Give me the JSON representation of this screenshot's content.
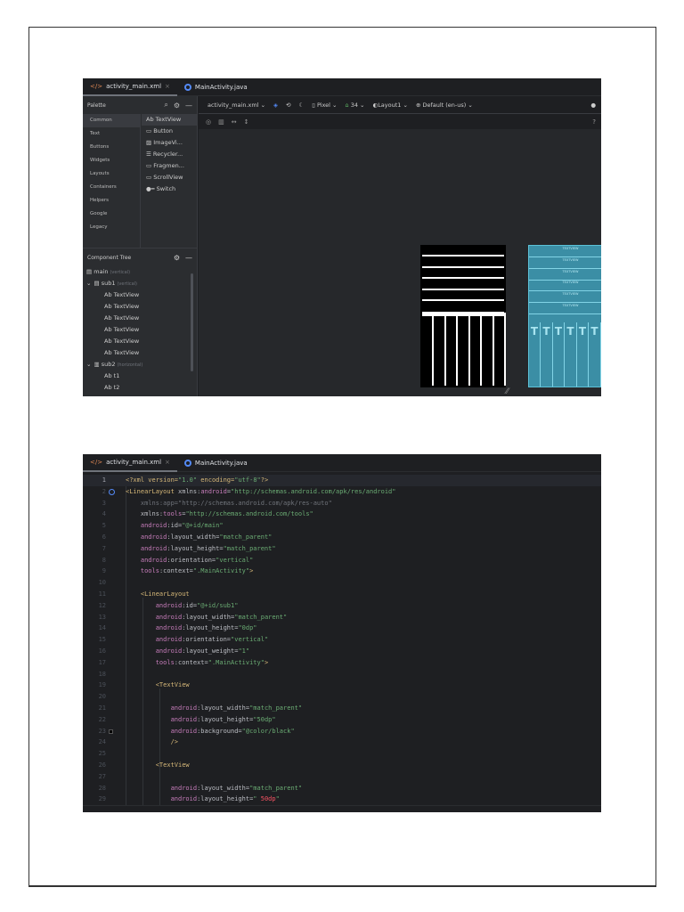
{
  "shot1": {
    "tabs": [
      {
        "label": "activity_main.xml",
        "close": "×"
      },
      {
        "label": "MainActivity.java"
      }
    ],
    "palette": {
      "title": "Palette",
      "categories": [
        "Common",
        "Text",
        "Buttons",
        "Widgets",
        "Layouts",
        "Containers",
        "Helpers",
        "Google",
        "Legacy"
      ],
      "widgets": [
        {
          "icon": "Ab",
          "label": "TextView"
        },
        {
          "icon": "▭",
          "label": "Button"
        },
        {
          "icon": "▨",
          "label": "ImageVi..."
        },
        {
          "icon": "☰",
          "label": "Recycler..."
        },
        {
          "icon": "▭",
          "label": "Fragmen..."
        },
        {
          "icon": "▭",
          "label": "ScrollView"
        },
        {
          "icon": "●━",
          "label": "Switch"
        }
      ]
    },
    "tree": {
      "title": "Component Tree",
      "rows": [
        {
          "indent": 0,
          "chev": "",
          "icon": "▤",
          "label": "main",
          "hint": "(vertical)"
        },
        {
          "indent": 0,
          "chev": "⌄",
          "icon": "▤",
          "label": "sub1",
          "hint": "(vertical)"
        },
        {
          "indent": 2,
          "chev": "",
          "icon": "Ab",
          "label": "TextView",
          "hint": ""
        },
        {
          "indent": 2,
          "chev": "",
          "icon": "Ab",
          "label": "TextView",
          "hint": ""
        },
        {
          "indent": 2,
          "chev": "",
          "icon": "Ab",
          "label": "TextView",
          "hint": ""
        },
        {
          "indent": 2,
          "chev": "",
          "icon": "Ab",
          "label": "TextView",
          "hint": ""
        },
        {
          "indent": 2,
          "chev": "",
          "icon": "Ab",
          "label": "TextView",
          "hint": ""
        },
        {
          "indent": 2,
          "chev": "",
          "icon": "Ab",
          "label": "TextView",
          "hint": ""
        },
        {
          "indent": 0,
          "chev": "⌄",
          "icon": "▥",
          "label": "sub2",
          "hint": "(horizontal)"
        },
        {
          "indent": 2,
          "chev": "",
          "icon": "Ab",
          "label": "t1",
          "hint": ""
        },
        {
          "indent": 2,
          "chev": "",
          "icon": "Ab",
          "label": "t2",
          "hint": ""
        }
      ]
    },
    "toolbar": {
      "file": "activity_main.xml ⌄",
      "device": "Pixel ⌄",
      "api": "34 ⌄",
      "theme": "Layout1 ⌄",
      "locale": "Default (en-us) ⌄",
      "help": "?"
    },
    "blueprint_label": "TEXTVIEW"
  },
  "shot2": {
    "tabs": [
      {
        "label": "activity_main.xml",
        "close": "×"
      },
      {
        "label": "MainActivity.java"
      }
    ],
    "lines": [
      [
        [
          "<?xml version=",
          "t-tag"
        ],
        [
          "\"1.0\"",
          "t-v"
        ],
        [
          " encoding=",
          "t-tag"
        ],
        [
          "\"utf-8\"",
          "t-v"
        ],
        [
          "?>",
          "t-tag"
        ]
      ],
      [
        [
          "<LinearLayout ",
          "t-tag"
        ],
        [
          "xmlns:",
          "t-at"
        ],
        [
          "android",
          "t-ns"
        ],
        [
          "=",
          "t-at"
        ],
        [
          "\"http://schemas.android.com/apk/res/android\"",
          "t-v"
        ]
      ],
      [
        [
          "    xmlns:app=\"http://schemas.android.com/apk/res-auto\"",
          "t-dim"
        ]
      ],
      [
        [
          "    xmlns:",
          "t-at"
        ],
        [
          "tools",
          "t-ns"
        ],
        [
          "=",
          "t-at"
        ],
        [
          "\"http://schemas.android.com/tools\"",
          "t-v"
        ]
      ],
      [
        [
          "    android",
          "t-ns"
        ],
        [
          ":id=",
          "t-at"
        ],
        [
          "\"@+id/main\"",
          "t-v"
        ]
      ],
      [
        [
          "    android",
          "t-ns"
        ],
        [
          ":layout_width=",
          "t-at"
        ],
        [
          "\"match_parent\"",
          "t-v"
        ]
      ],
      [
        [
          "    android",
          "t-ns"
        ],
        [
          ":layout_height=",
          "t-at"
        ],
        [
          "\"match_parent\"",
          "t-v"
        ]
      ],
      [
        [
          "    android",
          "t-ns"
        ],
        [
          ":orientation=",
          "t-at"
        ],
        [
          "\"vertical\"",
          "t-v"
        ]
      ],
      [
        [
          "    tools",
          "t-ns"
        ],
        [
          ":context=",
          "t-at"
        ],
        [
          "\".MainActivity\"",
          "t-v"
        ],
        [
          ">",
          "t-tag"
        ]
      ],
      [],
      [
        [
          "    <LinearLayout",
          "t-tag"
        ]
      ],
      [
        [
          "        android",
          "t-ns"
        ],
        [
          ":id=",
          "t-at"
        ],
        [
          "\"@+id/sub1\"",
          "t-v"
        ]
      ],
      [
        [
          "        android",
          "t-ns"
        ],
        [
          ":layout_width=",
          "t-at"
        ],
        [
          "\"match_parent\"",
          "t-v"
        ]
      ],
      [
        [
          "        android",
          "t-ns"
        ],
        [
          ":layout_height=",
          "t-at"
        ],
        [
          "\"0dp\"",
          "t-v"
        ]
      ],
      [
        [
          "        android",
          "t-ns"
        ],
        [
          ":orientation=",
          "t-at"
        ],
        [
          "\"vertical\"",
          "t-v"
        ]
      ],
      [
        [
          "        android",
          "t-ns"
        ],
        [
          ":layout_weight=",
          "t-at"
        ],
        [
          "\"1\"",
          "t-v"
        ]
      ],
      [
        [
          "        tools",
          "t-ns"
        ],
        [
          ":context=",
          "t-at"
        ],
        [
          "\".MainActivity\"",
          "t-v"
        ],
        [
          ">",
          "t-tag"
        ]
      ],
      [],
      [
        [
          "        <TextView",
          "t-tag"
        ]
      ],
      [],
      [
        [
          "            android",
          "t-ns"
        ],
        [
          ":layout_width=",
          "t-at"
        ],
        [
          "\"match_parent\"",
          "t-v"
        ]
      ],
      [
        [
          "            android",
          "t-ns"
        ],
        [
          ":layout_height=",
          "t-at"
        ],
        [
          "\"50dp\"",
          "t-v"
        ]
      ],
      [
        [
          "            android",
          "t-ns"
        ],
        [
          ":background=",
          "t-at"
        ],
        [
          "\"@color/black\"",
          "t-v"
        ]
      ],
      [
        [
          "            />",
          "t-tag"
        ]
      ],
      [],
      [
        [
          "        <TextView",
          "t-tag"
        ]
      ],
      [],
      [
        [
          "            android",
          "t-ns"
        ],
        [
          ":layout_width=",
          "t-at"
        ],
        [
          "\"match_parent\"",
          "t-v"
        ]
      ],
      [
        [
          "            android",
          "t-ns"
        ],
        [
          ":layout_height=",
          "t-at"
        ],
        [
          "\" ",
          "t-v"
        ],
        [
          "50dp",
          "t-err"
        ],
        [
          "\"",
          "t-v"
        ]
      ]
    ]
  }
}
